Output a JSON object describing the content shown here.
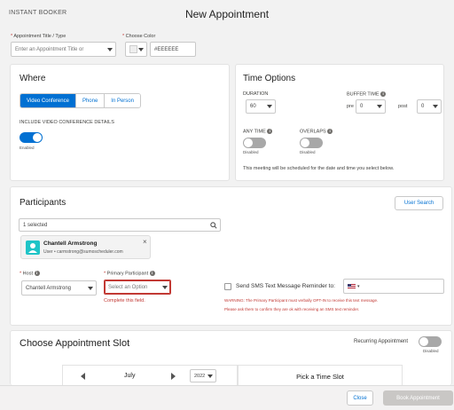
{
  "header": {
    "app_name": "INSTANT BOOKER",
    "title": "New Appointment"
  },
  "top_fields": {
    "appt_title_label": "Appointment Title / Type",
    "appt_title_placeholder": "Enter an Appointment Title or",
    "color_label": "Choose Color",
    "color_value": "#EEEEEE",
    "required_mark": "*"
  },
  "where": {
    "title": "Where",
    "options": [
      "Video Conference",
      "Phone",
      "In Person"
    ],
    "selected": "Video Conference",
    "include_label": "INCLUDE VIDEO CONFERENCE DETAILS",
    "toggle_state_label": "Enabled",
    "toggle_on": true
  },
  "time_options": {
    "title": "Time Options",
    "duration_label": "DURATION",
    "duration_value": "60",
    "buffer_label": "BUFFER TIME",
    "pre_label": "pre",
    "pre_value": "0",
    "post_label": "post",
    "post_value": "0",
    "any_time_label": "ANY TIME",
    "any_time_state": "Disabled",
    "overlaps_label": "OVERLAPS",
    "overlaps_state": "Disabled",
    "note": "This meeting will be scheduled for the date and time you select below."
  },
  "participants": {
    "title": "Participants",
    "user_search_label": "User Search",
    "search_value": "1 selected",
    "chip_name": "Chantell Armstrong",
    "chip_sub": "User • carmstrong@sumoscheduler.com",
    "chip_close": "×",
    "host_label": "Host",
    "host_value": "Chantell Armstrong",
    "primary_label": "Primary Participant",
    "primary_placeholder": "Select an Option",
    "primary_error": "Complete this field.",
    "sms_label": "Send SMS Text Message Reminder to:",
    "flag_caret": "▾",
    "warning_1": "WARNING: The Primary Participant must verbally OPT-IN to receive this text message.",
    "warning_2": "Please ask them to confirm they are ok with receiving an SMS text reminder."
  },
  "slot": {
    "title": "Choose Appointment Slot",
    "recurring_label": "Recurring Appointment",
    "recurring_state": "Disabled",
    "month": "July",
    "year": "2022",
    "pick_time": "Pick a Time Slot"
  },
  "footer": {
    "close_label": "Close",
    "book_label": "Book Appointment"
  },
  "colors": {
    "brand": "#0070d2",
    "error": "#c23934",
    "toggle_off": "#a8a8a8",
    "disabled_btn": "#c9c7c5"
  }
}
